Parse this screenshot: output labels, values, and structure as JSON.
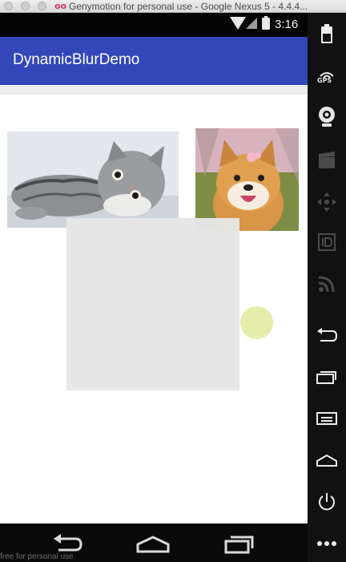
{
  "window": {
    "title": "Genymotion for personal use - Google Nexus 5 - 4.4.4..."
  },
  "statusbar": {
    "time": "3:16"
  },
  "app": {
    "title": "DynamicBlurDemo",
    "accent_color": "#3447b8"
  },
  "content": {
    "images": [
      {
        "name": "cat-photo",
        "subject": "cat"
      },
      {
        "name": "dog-photo",
        "subject": "dog"
      }
    ],
    "blur_overlay_color": "#e6e6e6",
    "dot_color": "#e4edaa"
  },
  "sidebar": {
    "gps_label": "GPS",
    "icons": [
      "battery-icon",
      "gps-icon",
      "webcam-icon",
      "clapper-icon",
      "dpad-icon",
      "id-icon",
      "rss-icon",
      "back-icon",
      "recent-apps-icon",
      "menu-icon",
      "home-icon",
      "power-icon",
      "more-icon"
    ]
  },
  "navbar": {
    "icons": [
      "back-icon",
      "home-icon",
      "recent-apps-icon"
    ]
  },
  "watermark": "free for personal use"
}
